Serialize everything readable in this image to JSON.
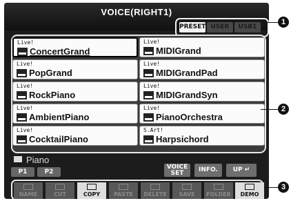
{
  "title": "VOICE(RIGHT1)",
  "tabs": {
    "preset": "PRESET",
    "user": "USER",
    "usb1": "USB1"
  },
  "voices": [
    {
      "category": "Live!",
      "name": "ConcertGrand",
      "selected": true
    },
    {
      "category": "Live!",
      "name": "MIDIGrand"
    },
    {
      "category": "Live!",
      "name": "PopGrand"
    },
    {
      "category": "Live!",
      "name": "MIDIGrandPad"
    },
    {
      "category": "Live!",
      "name": "RockPiano"
    },
    {
      "category": "Live!",
      "name": "MIDIGrandSyn"
    },
    {
      "category": "Live!",
      "name": "AmbientPiano"
    },
    {
      "category": "Live!",
      "name": "PianoOrchestra"
    },
    {
      "category": "Live!",
      "name": "CocktailPiano"
    },
    {
      "category": "S.Art!",
      "name": "Harpsichord"
    }
  ],
  "folder": "Piano",
  "pages": [
    "P1",
    "P2"
  ],
  "function_buttons": {
    "voice_set_1": "VOICE",
    "voice_set_2": "SET",
    "info": "INFO.",
    "up": "UP"
  },
  "bottom": {
    "name": "NAME",
    "cut": "CUT",
    "copy": "COPY",
    "paste": "PASTE",
    "delete": "DELETE",
    "save": "SAVE",
    "folder": "FOLDER",
    "demo": "DEMO"
  },
  "callouts": [
    "1",
    "2",
    "3"
  ]
}
